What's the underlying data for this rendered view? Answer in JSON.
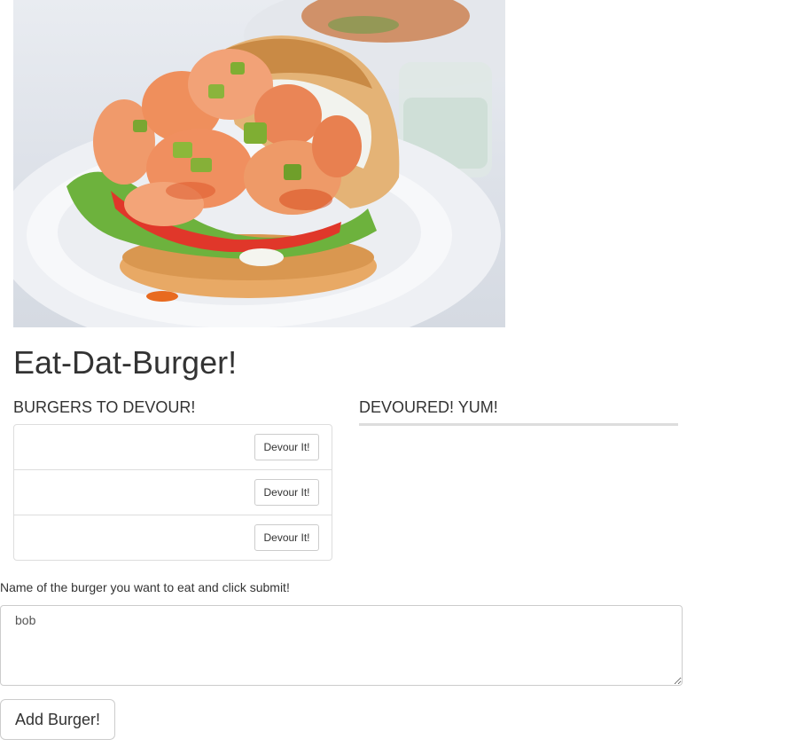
{
  "hero": {
    "image_icon": "shrimp-burger-photo"
  },
  "header": {
    "title": "Eat-Dat-Burger!"
  },
  "to_devour": {
    "heading": "BURGERS TO DEVOUR!",
    "items": [
      {
        "name": "",
        "button_label": "Devour It!"
      },
      {
        "name": "",
        "button_label": "Devour It!"
      },
      {
        "name": "",
        "button_label": "Devour It!"
      }
    ]
  },
  "devoured": {
    "heading": "DEVOURED! YUM!",
    "items": []
  },
  "form": {
    "label": "Name of the burger you want to eat and click submit!",
    "input_value": "bob",
    "submit_label": "Add Burger!"
  }
}
